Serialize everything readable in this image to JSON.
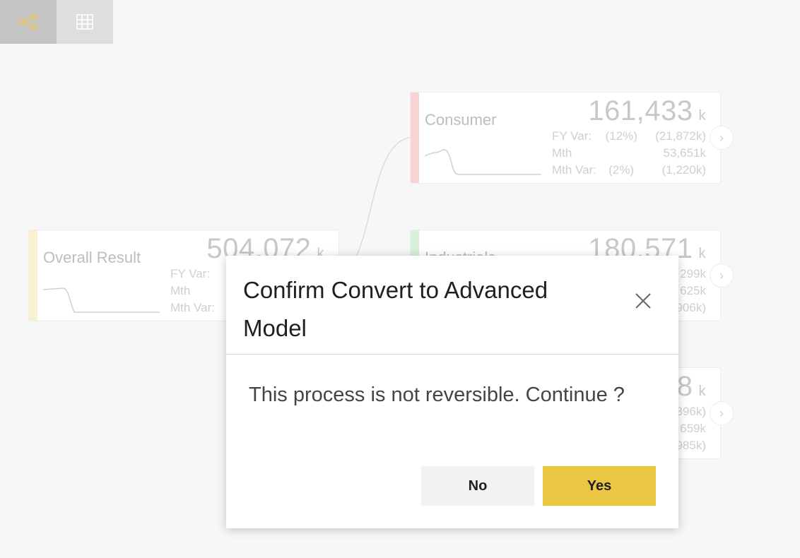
{
  "toolbar": {
    "tree_view_icon": "tree-diagram-icon",
    "table_view_icon": "grid-table-icon",
    "active_view": "tree",
    "accent_color": "#e7c96a"
  },
  "nodes": {
    "overall": {
      "title": "Overall Result",
      "value": "504,072",
      "unit": "k",
      "stripe_color": "#fbf0cf",
      "metrics": [
        {
          "label": "FY Var:",
          "pct": "",
          "value": ""
        },
        {
          "label": "Mth",
          "pct": "",
          "value": ""
        },
        {
          "label": "Mth Var:",
          "pct": "",
          "value": ""
        }
      ]
    },
    "consumer": {
      "title": "Consumer",
      "value": "161,433",
      "unit": "k",
      "stripe_color": "#f8d3d3",
      "metrics": [
        {
          "label": "FY Var:",
          "pct": "(12%)",
          "value": "(21,872k)"
        },
        {
          "label": "Mth",
          "pct": "",
          "value": "53,651k"
        },
        {
          "label": "Mth Var:",
          "pct": "(2%)",
          "value": "(1,220k)"
        }
      ]
    },
    "industrials": {
      "title": "Industrials",
      "value": "180,571",
      "unit": "k",
      "stripe_color": "#d9f0d9",
      "metrics": [
        {
          "label": "",
          "pct": "",
          "value": "299k"
        },
        {
          "label": "",
          "pct": "",
          "value": "625k"
        },
        {
          "label": "",
          "pct": "",
          "value": "906k)"
        }
      ]
    },
    "third": {
      "title": "",
      "value": "8",
      "unit": "k",
      "stripe_color": "#ffffff",
      "metrics": [
        {
          "label": "",
          "pct": "",
          "value": "396k)"
        },
        {
          "label": "",
          "pct": "",
          "value": "659k"
        },
        {
          "label": "",
          "pct": "",
          "value": "985k)"
        }
      ]
    }
  },
  "modal": {
    "title": "Confirm Convert to Advanced Model",
    "message": "This process is not reversible. Continue ?",
    "no_label": "No",
    "yes_label": "Yes",
    "yes_color": "#eac643",
    "close_icon": "close-icon"
  }
}
